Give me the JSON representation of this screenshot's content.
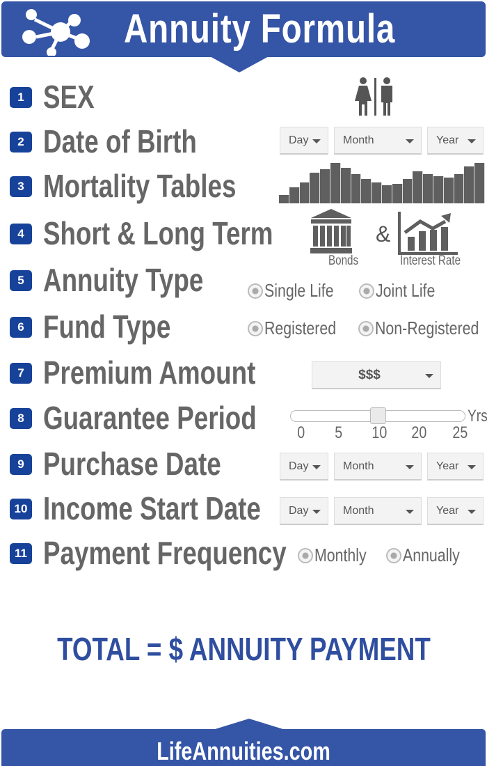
{
  "header": {
    "title": "Annuity Formula",
    "icon": "network-molecule-icon",
    "color": "#3555a6"
  },
  "steps": [
    {
      "number": "1",
      "label": "SEX"
    },
    {
      "number": "2",
      "label": "Date of Birth"
    },
    {
      "number": "3",
      "label": "Mortality Tables"
    },
    {
      "number": "4",
      "label": "Short & Long Term"
    },
    {
      "number": "5",
      "label": "Annuity Type"
    },
    {
      "number": "6",
      "label": "Fund Type"
    },
    {
      "number": "7",
      "label": "Premium Amount"
    },
    {
      "number": "8",
      "label": "Guarantee Period"
    },
    {
      "number": "9",
      "label": "Purchase Date"
    },
    {
      "number": "10",
      "label": "Income Start Date"
    },
    {
      "number": "11",
      "label": "Payment Frequency"
    }
  ],
  "date_select": {
    "day": "Day",
    "month": "Month",
    "year": "Year"
  },
  "mortality_bars": [
    0.2,
    0.4,
    0.52,
    0.76,
    0.84,
    1.0,
    0.88,
    0.72,
    0.6,
    0.52,
    0.44,
    0.48,
    0.6,
    0.8,
    0.72,
    0.68,
    0.64,
    0.72,
    0.92,
    1.0
  ],
  "terms": {
    "bonds": "Bonds",
    "ampersand": "&",
    "interest": "Interest Rate"
  },
  "annuity_type": {
    "options": [
      "Single Life",
      "Joint Life"
    ]
  },
  "fund_type": {
    "options": [
      "Registered",
      "Non-Registered"
    ]
  },
  "premium": {
    "value": "$$$"
  },
  "guarantee": {
    "ticks": [
      "0",
      "5",
      "10",
      "20",
      "25"
    ],
    "unit": "Yrs",
    "value": 10
  },
  "frequency": {
    "options": [
      "Monthly",
      "Annually"
    ]
  },
  "total": "TOTAL = $ ANNUITY PAYMENT",
  "footer": "LifeAnnuities.com"
}
